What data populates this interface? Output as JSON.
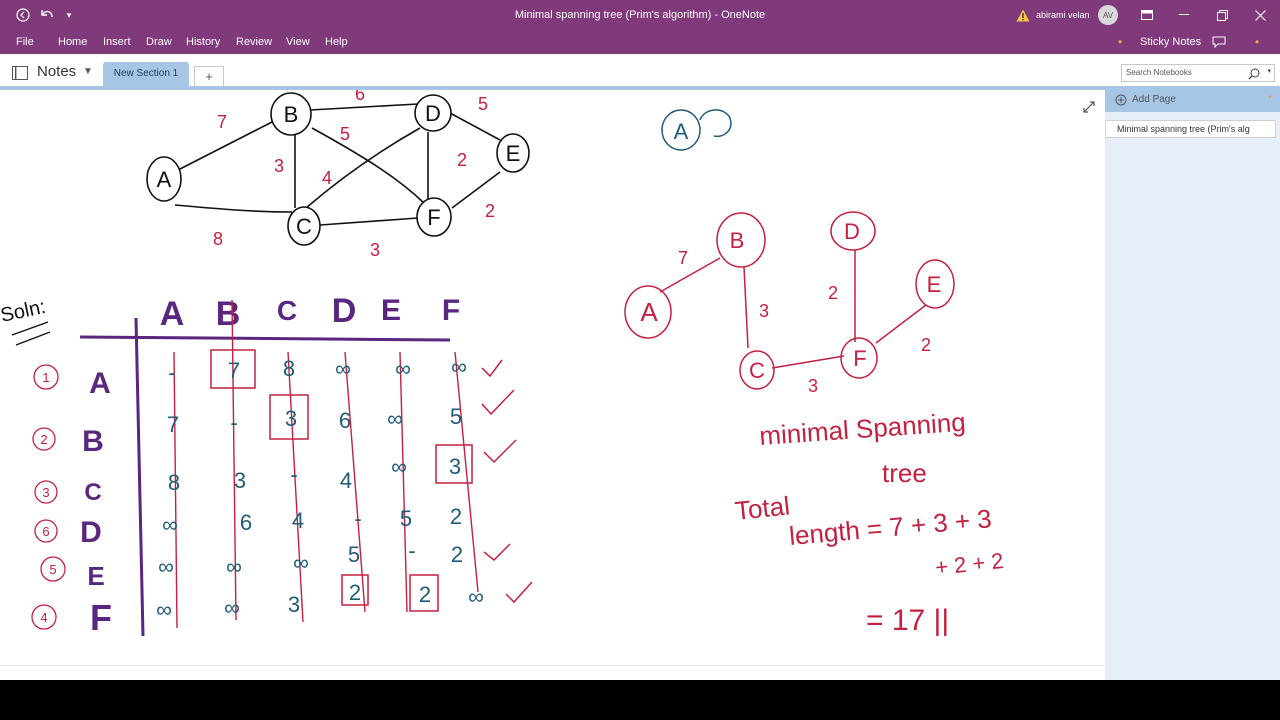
{
  "title_bar": {
    "window_title": "Minimal spanning tree (Prim's algorithm)  -  OneNote",
    "user_name": "abirami velan",
    "user_initials": "AV",
    "accent": "#80397b"
  },
  "menu": {
    "items": [
      "File",
      "Home",
      "Insert",
      "Draw",
      "History",
      "Review",
      "View",
      "Help"
    ],
    "sticky_notes": "Sticky Notes"
  },
  "notebook": {
    "name": "Notes",
    "section_tab": "New Section 1",
    "add_tab": "+",
    "search_placeholder": "Search Notebooks"
  },
  "pages_pane": {
    "add_page": "Add Page",
    "pages": [
      "Minimal spanning tree (Prim's alg"
    ]
  },
  "ink": {
    "graph_nodes": [
      "A",
      "B",
      "C",
      "D",
      "E",
      "F"
    ],
    "graph_weights": [
      "7",
      "6",
      "5",
      "5",
      "3",
      "4",
      "2",
      "2",
      "8",
      "3"
    ],
    "legend_node": "A",
    "soln_label": "Soln:",
    "table_headers": [
      "A",
      "B",
      "C",
      "D",
      "E",
      "F"
    ],
    "step_numbers": [
      "1",
      "2",
      "3",
      "6",
      "5",
      "4"
    ],
    "table_rows": [
      {
        "label": "A",
        "cells": [
          "-",
          "7",
          "8",
          "∞",
          "∞",
          "∞"
        ]
      },
      {
        "label": "B",
        "cells": [
          "7",
          "-",
          "3",
          "6",
          "∞",
          "5"
        ]
      },
      {
        "label": "C",
        "cells": [
          "8",
          "3",
          "-",
          "4",
          "∞",
          "3"
        ]
      },
      {
        "label": "D",
        "cells": [
          "∞",
          "6",
          "4",
          "-",
          "5",
          "2"
        ]
      },
      {
        "label": "E",
        "cells": [
          "∞",
          "∞",
          "∞",
          "5",
          "-",
          "2"
        ]
      },
      {
        "label": "F",
        "cells": [
          "∞",
          "∞",
          "3",
          "2",
          "2",
          "∞"
        ]
      }
    ],
    "mst_nodes": [
      "A",
      "B",
      "C",
      "D",
      "E",
      "F"
    ],
    "mst_weights": [
      "7",
      "3",
      "2",
      "3",
      "2"
    ],
    "mst_caption_1": "minimal Spanning",
    "mst_caption_2": "tree",
    "total_label": "Total",
    "total_expr_1": "length = 7 + 3 + 3",
    "total_expr_2": "+ 2 + 2",
    "total_result": "= 17 ||"
  }
}
